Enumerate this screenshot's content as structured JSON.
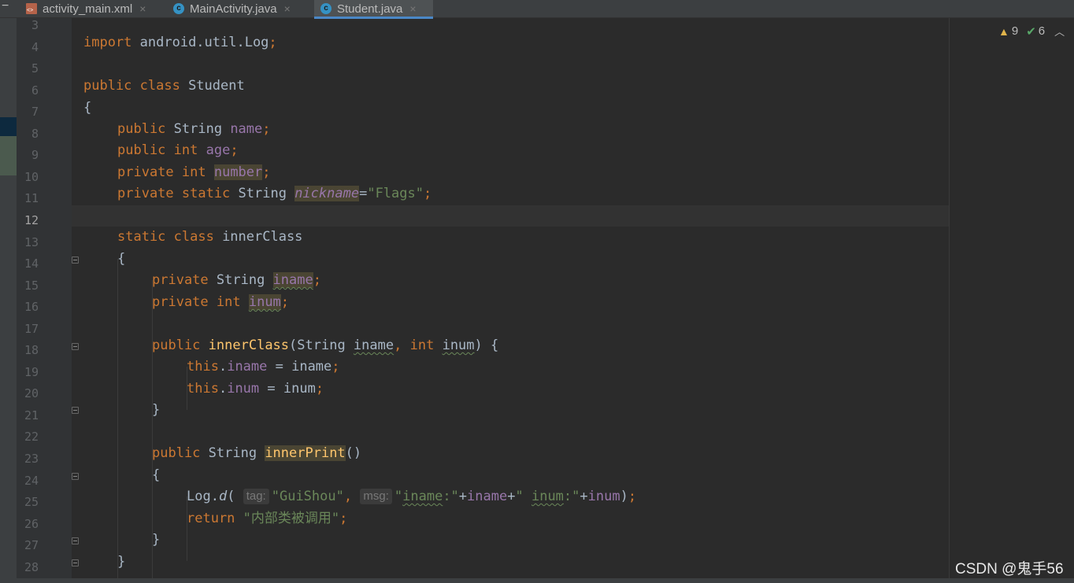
{
  "tabs": [
    {
      "label": "activity_main.xml",
      "icon": "xml-file-icon",
      "active": false
    },
    {
      "label": "MainActivity.java",
      "icon": "java-class-icon",
      "active": false
    },
    {
      "label": "Student.java",
      "icon": "java-class-icon",
      "active": true
    }
  ],
  "tab_close_glyph": "×",
  "inspections": {
    "warnings": "9",
    "weak_warnings": "6"
  },
  "current_line": "12",
  "line_numbers": [
    "3",
    "4",
    "5",
    "6",
    "7",
    "8",
    "9",
    "10",
    "11",
    "12",
    "13",
    "14",
    "15",
    "16",
    "17",
    "18",
    "19",
    "20",
    "21",
    "22",
    "23",
    "24",
    "25",
    "26",
    "27",
    "28"
  ],
  "code": {
    "l4": {
      "kw": "import",
      "rest": " android.util.Log",
      "semi": ";"
    },
    "l6": {
      "kw": "public class",
      "name": " Student"
    },
    "l7": {
      "text": "{"
    },
    "l8": {
      "kw": "public",
      "type": " String ",
      "field": "name",
      "semi": ";"
    },
    "l9": {
      "kw": "public int",
      "field": "age",
      "semi": ";"
    },
    "l10": {
      "kw": "private int",
      "field": "number",
      "semi": ";"
    },
    "l11": {
      "kw": "private static",
      "type": " String ",
      "field": "nickname",
      "eq": "=",
      "str": "\"Flags\"",
      "semi": ";"
    },
    "l13": {
      "kw": "static class",
      "name": " innerClass"
    },
    "l14": {
      "text": "{"
    },
    "l15": {
      "kw": "private",
      "type": " String ",
      "field": "iname",
      "semi": ";"
    },
    "l16": {
      "kw": "private int",
      "field": "inum",
      "semi": ";"
    },
    "l18": {
      "kw": "public",
      "fn": "innerClass",
      "p1": "(String ",
      "a1": "iname",
      "comma": ",",
      "kw2": "int",
      "a2": "inum",
      "close": ") {"
    },
    "l19": {
      "kw": "this",
      "dot": ".",
      "field": "iname",
      "rest": " = iname",
      "semi": ";"
    },
    "l20": {
      "kw": "this",
      "dot": ".",
      "field": "inum",
      "rest": " = inum",
      "semi": ";"
    },
    "l21": {
      "text": "}"
    },
    "l23": {
      "kw": "public",
      "type": " String ",
      "fn": "innerPrint",
      "rest": "()"
    },
    "l24": {
      "text": "{"
    },
    "l25": {
      "obj": "Log.",
      "method": "d",
      "open": "(",
      "hint1": "tag:",
      "str1": "\"GuiShou\"",
      "comma": ",",
      "hint2": "msg:",
      "q1": "\"",
      "s2": "iname",
      "s2b": ":\"",
      "plus1": "+",
      "field1": "iname",
      "plus2": "+",
      "q2": "\" ",
      "s3": "inum",
      "s3b": ":\"",
      "plus3": "+",
      "field2": "inum",
      "close": ")",
      "semi": ";"
    },
    "l26": {
      "kw": "return",
      "str": "\"内部类被调用\"",
      "semi": ";"
    },
    "l27": {
      "text": "}"
    },
    "l28": {
      "text": "}"
    }
  },
  "watermark": "CSDN @鬼手56",
  "colors": {
    "background": "#2b2b2b",
    "keyword": "#cc7832",
    "field": "#9876aa",
    "string": "#6a8759",
    "method": "#ffc66d",
    "text": "#a9b7c6",
    "tab_underline": "#4a88c7"
  }
}
